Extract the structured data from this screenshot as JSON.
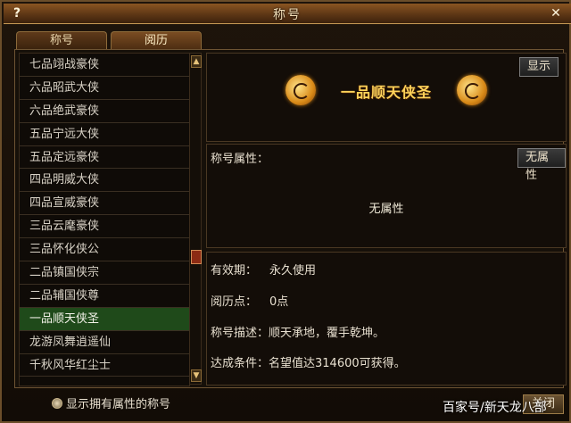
{
  "window": {
    "title": "称号",
    "help": "?",
    "close": "✕"
  },
  "tabs": [
    {
      "label": "称号"
    },
    {
      "label": "阅历"
    }
  ],
  "list": {
    "items": [
      "七品翊战豪侠",
      "六品昭武大侠",
      "六品绝武豪侠",
      "五品宁远大侠",
      "五品定远豪侠",
      "四品明威大侠",
      "四品宣威豪侠",
      "三品云麾豪侠",
      "三品怀化侠公",
      "二品镇国侠宗",
      "二品辅国侠尊",
      "一品顺天侠圣",
      "龙游凤舞逍遥仙",
      "千秋风华红尘士"
    ],
    "selected_index": 11
  },
  "scroll": {
    "up": "▲",
    "down": "▼"
  },
  "title_panel": {
    "show_button": "显示",
    "title_name": "一品顺天侠圣"
  },
  "attr_panel": {
    "label": "称号属性：",
    "button": "无属性",
    "value": "无属性"
  },
  "info": {
    "validity_label": "有效期：",
    "validity_value": "永久使用",
    "points_label": "阅历点：",
    "points_value": "0点",
    "desc_label": "称号描述：",
    "desc_value": "顺天承地，覆手乾坤。",
    "condition_label": "达成条件：",
    "condition_value": "名望值达314600可获得。"
  },
  "footer": {
    "checkbox_label": "显示拥有属性的称号",
    "close_button": "关闭"
  },
  "watermark": "百家号/新天龙八部",
  "colors": {
    "selected_row": "#1f4a1a",
    "title_gold": "#ffd35a",
    "frame_brown": "#6b4e2a"
  }
}
